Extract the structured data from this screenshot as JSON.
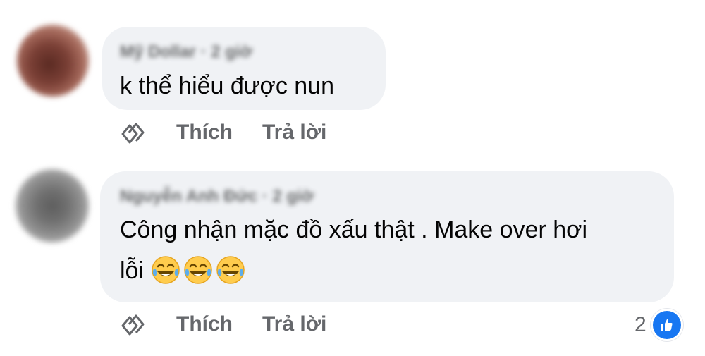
{
  "comments": [
    {
      "author": "Mỹ Dollar · 2 giờ",
      "text": "k thể hiểu được nun",
      "actions": {
        "like": "Thích",
        "reply": "Trả lời"
      }
    },
    {
      "author": "Nguyễn Anh Đức · 2 giờ",
      "text": "Công nhận mặc đồ xấu thật . Make over hơi\nlỗi ",
      "emojis": [
        "tears-of-joy-icon",
        "tears-of-joy-icon",
        "tears-of-joy-icon"
      ],
      "actions": {
        "like": "Thích",
        "reply": "Trả lời"
      },
      "reactions": {
        "count": "2",
        "type": "like-icon",
        "color": "#1877f2"
      }
    }
  ],
  "colors": {
    "bubble": "#f0f2f5",
    "text": "#050505",
    "secondary": "#65676b",
    "like_blue": "#1877f2"
  }
}
